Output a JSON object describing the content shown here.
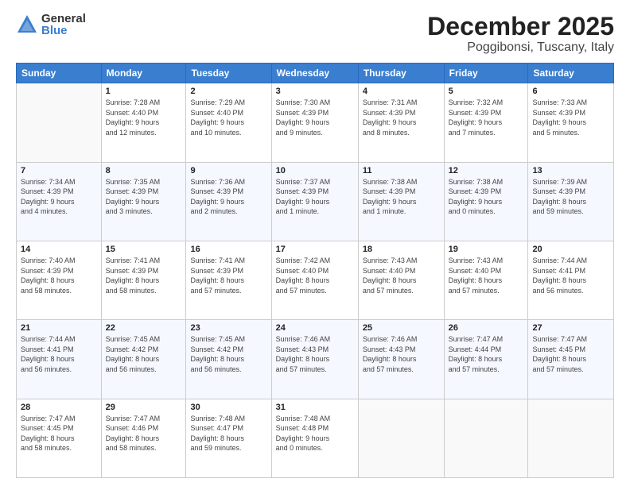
{
  "logo": {
    "general": "General",
    "blue": "Blue"
  },
  "calendar": {
    "title": "December 2025",
    "subtitle": "Poggibonsi, Tuscany, Italy"
  },
  "weekdays": [
    "Sunday",
    "Monday",
    "Tuesday",
    "Wednesday",
    "Thursday",
    "Friday",
    "Saturday"
  ],
  "weeks": [
    [
      {
        "day": "",
        "info": ""
      },
      {
        "day": "1",
        "info": "Sunrise: 7:28 AM\nSunset: 4:40 PM\nDaylight: 9 hours\nand 12 minutes."
      },
      {
        "day": "2",
        "info": "Sunrise: 7:29 AM\nSunset: 4:40 PM\nDaylight: 9 hours\nand 10 minutes."
      },
      {
        "day": "3",
        "info": "Sunrise: 7:30 AM\nSunset: 4:39 PM\nDaylight: 9 hours\nand 9 minutes."
      },
      {
        "day": "4",
        "info": "Sunrise: 7:31 AM\nSunset: 4:39 PM\nDaylight: 9 hours\nand 8 minutes."
      },
      {
        "day": "5",
        "info": "Sunrise: 7:32 AM\nSunset: 4:39 PM\nDaylight: 9 hours\nand 7 minutes."
      },
      {
        "day": "6",
        "info": "Sunrise: 7:33 AM\nSunset: 4:39 PM\nDaylight: 9 hours\nand 5 minutes."
      }
    ],
    [
      {
        "day": "7",
        "info": "Sunrise: 7:34 AM\nSunset: 4:39 PM\nDaylight: 9 hours\nand 4 minutes."
      },
      {
        "day": "8",
        "info": "Sunrise: 7:35 AM\nSunset: 4:39 PM\nDaylight: 9 hours\nand 3 minutes."
      },
      {
        "day": "9",
        "info": "Sunrise: 7:36 AM\nSunset: 4:39 PM\nDaylight: 9 hours\nand 2 minutes."
      },
      {
        "day": "10",
        "info": "Sunrise: 7:37 AM\nSunset: 4:39 PM\nDaylight: 9 hours\nand 1 minute."
      },
      {
        "day": "11",
        "info": "Sunrise: 7:38 AM\nSunset: 4:39 PM\nDaylight: 9 hours\nand 1 minute."
      },
      {
        "day": "12",
        "info": "Sunrise: 7:38 AM\nSunset: 4:39 PM\nDaylight: 9 hours\nand 0 minutes."
      },
      {
        "day": "13",
        "info": "Sunrise: 7:39 AM\nSunset: 4:39 PM\nDaylight: 8 hours\nand 59 minutes."
      }
    ],
    [
      {
        "day": "14",
        "info": "Sunrise: 7:40 AM\nSunset: 4:39 PM\nDaylight: 8 hours\nand 58 minutes."
      },
      {
        "day": "15",
        "info": "Sunrise: 7:41 AM\nSunset: 4:39 PM\nDaylight: 8 hours\nand 58 minutes."
      },
      {
        "day": "16",
        "info": "Sunrise: 7:41 AM\nSunset: 4:39 PM\nDaylight: 8 hours\nand 57 minutes."
      },
      {
        "day": "17",
        "info": "Sunrise: 7:42 AM\nSunset: 4:40 PM\nDaylight: 8 hours\nand 57 minutes."
      },
      {
        "day": "18",
        "info": "Sunrise: 7:43 AM\nSunset: 4:40 PM\nDaylight: 8 hours\nand 57 minutes."
      },
      {
        "day": "19",
        "info": "Sunrise: 7:43 AM\nSunset: 4:40 PM\nDaylight: 8 hours\nand 57 minutes."
      },
      {
        "day": "20",
        "info": "Sunrise: 7:44 AM\nSunset: 4:41 PM\nDaylight: 8 hours\nand 56 minutes."
      }
    ],
    [
      {
        "day": "21",
        "info": "Sunrise: 7:44 AM\nSunset: 4:41 PM\nDaylight: 8 hours\nand 56 minutes."
      },
      {
        "day": "22",
        "info": "Sunrise: 7:45 AM\nSunset: 4:42 PM\nDaylight: 8 hours\nand 56 minutes."
      },
      {
        "day": "23",
        "info": "Sunrise: 7:45 AM\nSunset: 4:42 PM\nDaylight: 8 hours\nand 56 minutes."
      },
      {
        "day": "24",
        "info": "Sunrise: 7:46 AM\nSunset: 4:43 PM\nDaylight: 8 hours\nand 57 minutes."
      },
      {
        "day": "25",
        "info": "Sunrise: 7:46 AM\nSunset: 4:43 PM\nDaylight: 8 hours\nand 57 minutes."
      },
      {
        "day": "26",
        "info": "Sunrise: 7:47 AM\nSunset: 4:44 PM\nDaylight: 8 hours\nand 57 minutes."
      },
      {
        "day": "27",
        "info": "Sunrise: 7:47 AM\nSunset: 4:45 PM\nDaylight: 8 hours\nand 57 minutes."
      }
    ],
    [
      {
        "day": "28",
        "info": "Sunrise: 7:47 AM\nSunset: 4:45 PM\nDaylight: 8 hours\nand 58 minutes."
      },
      {
        "day": "29",
        "info": "Sunrise: 7:47 AM\nSunset: 4:46 PM\nDaylight: 8 hours\nand 58 minutes."
      },
      {
        "day": "30",
        "info": "Sunrise: 7:48 AM\nSunset: 4:47 PM\nDaylight: 8 hours\nand 59 minutes."
      },
      {
        "day": "31",
        "info": "Sunrise: 7:48 AM\nSunset: 4:48 PM\nDaylight: 9 hours\nand 0 minutes."
      },
      {
        "day": "",
        "info": ""
      },
      {
        "day": "",
        "info": ""
      },
      {
        "day": "",
        "info": ""
      }
    ]
  ]
}
